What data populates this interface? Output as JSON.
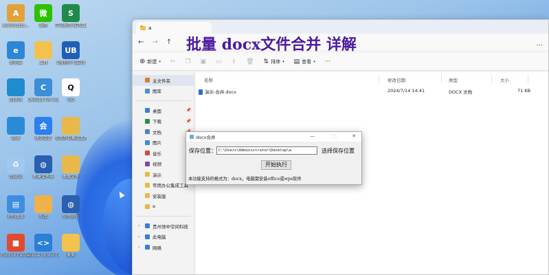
{
  "desktop": {
    "icons": [
      {
        "label": "Administra...",
        "color": "#e2a23b",
        "glyph": "A"
      },
      {
        "label": "微信",
        "color": "#2dc100",
        "glyph": "微"
      },
      {
        "label": "学以致用 技巧汇总.xlsx",
        "color": "#1e8a4c",
        "glyph": "S"
      },
      {
        "label": "此电脑",
        "color": "#2f86d6",
        "glyph": "e"
      },
      {
        "label": "工具",
        "color": "#f2c14e",
        "glyph": ""
      },
      {
        "label": "U盘制作 U启动",
        "color": "#1f5fb8",
        "glyph": "UB"
      },
      {
        "label": "回收站",
        "color": "#1f8ccf",
        "glyph": ""
      },
      {
        "label": "CASS11 For AutoCAD",
        "color": "#3b8ed8",
        "glyph": "C"
      },
      {
        "label": "QQ",
        "color": "#ffffff",
        "glyph": "Q"
      },
      {
        "label": "网络",
        "color": "#2a8ad8",
        "glyph": ""
      },
      {
        "label": "腾讯会议",
        "color": "#2d7ef0",
        "glyph": "会"
      },
      {
        "label": "常用办公集成工具",
        "color": "#e8b94a",
        "glyph": ""
      },
      {
        "label": "回收站",
        "color": "#9fc8ef",
        "glyph": "♻"
      },
      {
        "label": "新建文件夹",
        "color": "#2b5fb0",
        "glyph": "◍"
      },
      {
        "label": "桌面文件",
        "color": "#e8b94a",
        "glyph": ""
      },
      {
        "label": "控制面板",
        "color": "#3d8ee0",
        "glyph": "▤"
      },
      {
        "label": "作品",
        "color": "#f0b04a",
        "glyph": ""
      },
      {
        "label": "常用网址",
        "color": "#2b5fb0",
        "glyph": "◍"
      },
      {
        "label": "Control Center",
        "color": "#e04a2f",
        "glyph": "■"
      },
      {
        "label": "Visual Studio Code",
        "color": "#2a7fd6",
        "glyph": "<>"
      },
      {
        "label": "桌面",
        "color": "#f2c14e",
        "glyph": ""
      }
    ]
  },
  "explorer": {
    "tab_title": "a",
    "overlay_title": "批量 docx文件合并 详解",
    "toolbar": {
      "new_label": "新建",
      "sort_label": "排序",
      "view_label": "查看",
      "more_label": "···"
    },
    "sidebar": {
      "top": [
        {
          "label": "主文件夹",
          "color": "#d77a3a"
        },
        {
          "label": "图库",
          "color": "#4a8fd8"
        }
      ],
      "pinned": [
        {
          "label": "桌面",
          "color": "#3b7be0"
        },
        {
          "label": "下载",
          "color": "#2f8a4a"
        },
        {
          "label": "文档",
          "color": "#5a7fb8"
        },
        {
          "label": "图片",
          "color": "#3b8ed8"
        },
        {
          "label": "音乐",
          "color": "#d84a3a"
        },
        {
          "label": "视频",
          "color": "#7a4ab8"
        },
        {
          "label": "演示",
          "color": "#e8b94a"
        },
        {
          "label": "常用办公集成工具",
          "color": "#e8b94a"
        },
        {
          "label": "安装版",
          "color": "#e8b94a"
        },
        {
          "label": "a",
          "color": "#e8b94a"
        }
      ],
      "bottom": [
        {
          "label": "贵州领中空间科技",
          "color": "#3b7be0"
        },
        {
          "label": "此电脑",
          "color": "#3b7be0"
        },
        {
          "label": "网络",
          "color": "#3b7be0"
        }
      ]
    },
    "columns": {
      "name": "名称",
      "modified": "修改日期",
      "type": "类型",
      "size": "大小"
    },
    "files": [
      {
        "name": "演示-合并.docx",
        "modified": "2024/7/14 14:41",
        "type": "DOCX 文档",
        "size": "71 KB"
      }
    ]
  },
  "dialog": {
    "title": "docx合并",
    "save_label": "保存位置：",
    "path_value": "C:\\Users\\Administrator\\Desktop\\a",
    "choose_button": "选择保存位置",
    "run_button": "开始执行",
    "note": "本功能支持的格式为：docx，电脑需安装office或wps软件"
  }
}
